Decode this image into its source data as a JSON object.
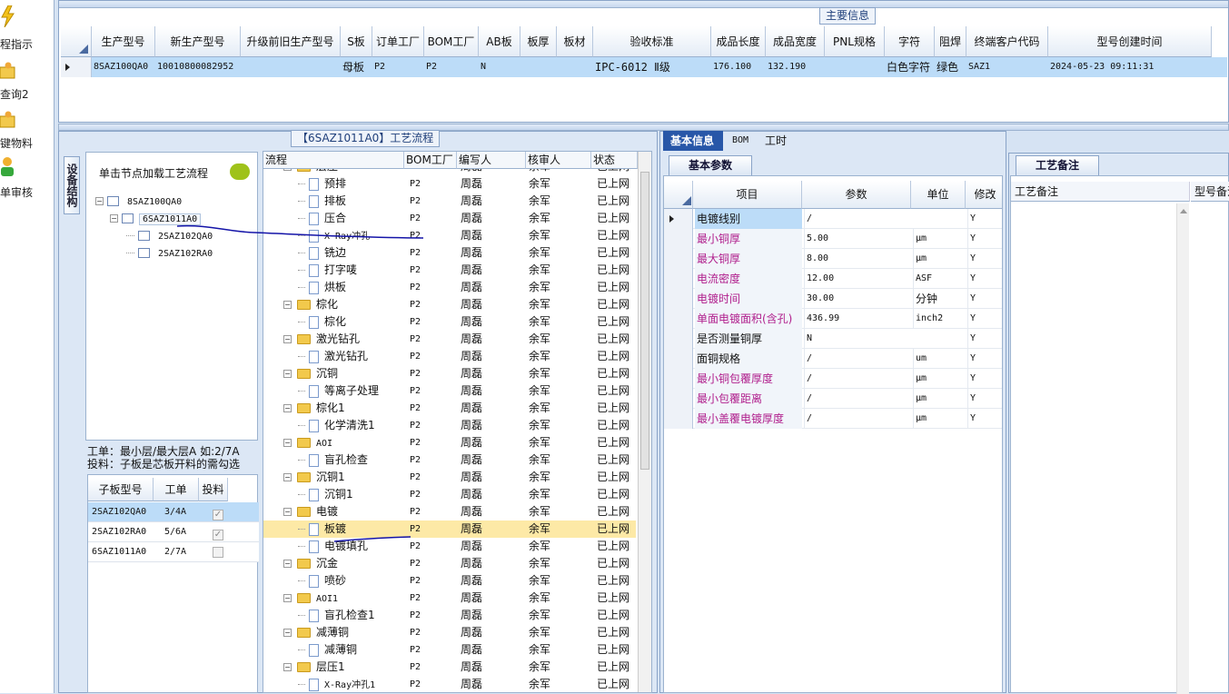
{
  "left_nav": {
    "items": [
      {
        "label": "程指示",
        "icon": "lightning-icon"
      },
      {
        "label": "查询2",
        "icon": "folder-person-icon"
      },
      {
        "label": "键物料",
        "icon": "folder-person-icon"
      },
      {
        "label": "单审核",
        "icon": "user-icon"
      }
    ]
  },
  "main_info": {
    "group_title": "主要信息",
    "columns": [
      "生产型号",
      "新生产型号",
      "升级前旧生产型号",
      "S板",
      "订单工厂",
      "BOM工厂",
      "AB板",
      "板厚",
      "板材",
      "验收标准",
      "成品长度",
      "成品宽度",
      "PNL规格",
      "字符",
      "阻焊",
      "终端客户代码",
      "型号创建时间"
    ],
    "row": [
      "8SAZ100QA0",
      "10010800082952",
      "",
      "母板",
      "P2",
      "P2",
      "N",
      "",
      "",
      "IPC-6012 Ⅱ级",
      "176.100",
      "132.190",
      "",
      "白色字符",
      "绿色",
      "SAZ1",
      "2024-05-23 09:11:31"
    ]
  },
  "flow_panel": {
    "title": "【6SAZ1011A0】工艺流程",
    "side_tab": "设备结构",
    "tree_hint": "单击节点加载工艺流程",
    "tree": [
      {
        "label": "8SAZ100QA0",
        "level": 0
      },
      {
        "label": "6SAZ1011A0",
        "level": 1
      },
      {
        "label": "2SAZ102QA0",
        "level": 2
      },
      {
        "label": "2SAZ102RA0",
        "level": 2
      }
    ],
    "note_line1": "工单：最小层/最大层A 如:2/7A",
    "note_line2": "投料：子板是芯板开料的需勾选",
    "sub_columns": [
      "子板型号",
      "工单",
      "投料"
    ],
    "sub_rows": [
      {
        "model": "2SAZ102QA0",
        "order": "3/4A",
        "feed": true
      },
      {
        "model": "2SAZ102RA0",
        "order": "5/6A",
        "feed": true
      },
      {
        "model": "6SAZ1011A0",
        "order": "2/7A",
        "feed": false
      }
    ],
    "flow_columns": [
      "流程",
      "BOM工厂",
      "编写人",
      "核审人",
      "状态"
    ],
    "flow_rows": [
      {
        "name": "层压",
        "type": "folder",
        "factory": "P2",
        "writer": "周磊",
        "checker": "余军",
        "status": "已上网"
      },
      {
        "name": "预排",
        "type": "doc",
        "factory": "P2",
        "writer": "周磊",
        "checker": "余军",
        "status": "已上网"
      },
      {
        "name": "排板",
        "type": "doc",
        "factory": "P2",
        "writer": "周磊",
        "checker": "余军",
        "status": "已上网"
      },
      {
        "name": "压合",
        "type": "doc",
        "factory": "P2",
        "writer": "周磊",
        "checker": "余军",
        "status": "已上网"
      },
      {
        "name": "X-Ray冲孔",
        "type": "doc",
        "factory": "P2",
        "writer": "周磊",
        "checker": "余军",
        "status": "已上网"
      },
      {
        "name": "铣边",
        "type": "doc",
        "factory": "P2",
        "writer": "周磊",
        "checker": "余军",
        "status": "已上网"
      },
      {
        "name": "打字唛",
        "type": "doc",
        "factory": "P2",
        "writer": "周磊",
        "checker": "余军",
        "status": "已上网"
      },
      {
        "name": "烘板",
        "type": "doc",
        "factory": "P2",
        "writer": "周磊",
        "checker": "余军",
        "status": "已上网"
      },
      {
        "name": "棕化",
        "type": "folder",
        "factory": "P2",
        "writer": "周磊",
        "checker": "余军",
        "status": "已上网"
      },
      {
        "name": "棕化",
        "type": "doc",
        "factory": "P2",
        "writer": "周磊",
        "checker": "余军",
        "status": "已上网"
      },
      {
        "name": "激光钻孔",
        "type": "folder",
        "factory": "P2",
        "writer": "周磊",
        "checker": "余军",
        "status": "已上网"
      },
      {
        "name": "激光钻孔",
        "type": "doc",
        "factory": "P2",
        "writer": "周磊",
        "checker": "余军",
        "status": "已上网"
      },
      {
        "name": "沉铜",
        "type": "folder",
        "factory": "P2",
        "writer": "周磊",
        "checker": "余军",
        "status": "已上网"
      },
      {
        "name": "等离子处理",
        "type": "doc",
        "factory": "P2",
        "writer": "周磊",
        "checker": "余军",
        "status": "已上网"
      },
      {
        "name": "棕化1",
        "type": "folder",
        "factory": "P2",
        "writer": "周磊",
        "checker": "余军",
        "status": "已上网"
      },
      {
        "name": "化学清洗1",
        "type": "doc",
        "factory": "P2",
        "writer": "周磊",
        "checker": "余军",
        "status": "已上网"
      },
      {
        "name": "AOI",
        "type": "folder",
        "factory": "P2",
        "writer": "周磊",
        "checker": "余军",
        "status": "已上网"
      },
      {
        "name": "盲孔检查",
        "type": "doc",
        "factory": "P2",
        "writer": "周磊",
        "checker": "余军",
        "status": "已上网"
      },
      {
        "name": "沉铜1",
        "type": "folder",
        "factory": "P2",
        "writer": "周磊",
        "checker": "余军",
        "status": "已上网"
      },
      {
        "name": "沉铜1",
        "type": "doc",
        "factory": "P2",
        "writer": "周磊",
        "checker": "余军",
        "status": "已上网"
      },
      {
        "name": "电镀",
        "type": "folder",
        "factory": "P2",
        "writer": "周磊",
        "checker": "余军",
        "status": "已上网"
      },
      {
        "name": "板镀",
        "type": "doc",
        "factory": "P2",
        "writer": "周磊",
        "checker": "余军",
        "status": "已上网",
        "selected": true
      },
      {
        "name": "电镀填孔",
        "type": "doc",
        "factory": "P2",
        "writer": "周磊",
        "checker": "余军",
        "status": "已上网"
      },
      {
        "name": "沉金",
        "type": "folder",
        "factory": "P2",
        "writer": "周磊",
        "checker": "余军",
        "status": "已上网"
      },
      {
        "name": "喷砂",
        "type": "doc",
        "factory": "P2",
        "writer": "周磊",
        "checker": "余军",
        "status": "已上网"
      },
      {
        "name": "AOI1",
        "type": "folder",
        "factory": "P2",
        "writer": "周磊",
        "checker": "余军",
        "status": "已上网"
      },
      {
        "name": "盲孔检查1",
        "type": "doc",
        "factory": "P2",
        "writer": "周磊",
        "checker": "余军",
        "status": "已上网"
      },
      {
        "name": "减薄铜",
        "type": "folder",
        "factory": "P2",
        "writer": "周磊",
        "checker": "余军",
        "status": "已上网"
      },
      {
        "name": "减薄铜",
        "type": "doc",
        "factory": "P2",
        "writer": "周磊",
        "checker": "余军",
        "status": "已上网"
      },
      {
        "name": "层压1",
        "type": "folder",
        "factory": "P2",
        "writer": "周磊",
        "checker": "余军",
        "status": "已上网"
      },
      {
        "name": "X-Ray冲孔1",
        "type": "doc",
        "factory": "P2",
        "writer": "周磊",
        "checker": "余军",
        "status": "已上网"
      }
    ]
  },
  "detail_panel": {
    "tabs": [
      "基本信息",
      "BOM",
      "工时"
    ],
    "subtab": "基本参数",
    "columns": [
      "项目",
      "参数",
      "单位",
      "修改"
    ],
    "rows": [
      {
        "item": "电镀线别",
        "param": "/",
        "unit": "",
        "mod": "Y",
        "pink": false
      },
      {
        "item": "最小铜厚",
        "param": "5.00",
        "unit": "μm",
        "mod": "Y",
        "pink": true
      },
      {
        "item": "最大铜厚",
        "param": "8.00",
        "unit": "μm",
        "mod": "Y",
        "pink": true
      },
      {
        "item": "电流密度",
        "param": "12.00",
        "unit": "ASF",
        "mod": "Y",
        "pink": true
      },
      {
        "item": "电镀时间",
        "param": "30.00",
        "unit": "分钟",
        "mod": "Y",
        "pink": true
      },
      {
        "item": "单面电镀面积(含孔)",
        "param": "436.99",
        "unit": "inch2",
        "mod": "Y",
        "pink": true
      },
      {
        "item": "是否测量铜厚",
        "param": "N",
        "unit": "",
        "mod": "Y",
        "pink": false
      },
      {
        "item": "面铜规格",
        "param": "/",
        "unit": "um",
        "mod": "Y",
        "pink": false
      },
      {
        "item": "最小铜包覆厚度",
        "param": "/",
        "unit": "μm",
        "mod": "Y",
        "pink": true
      },
      {
        "item": "最小包覆距离",
        "param": "/",
        "unit": "μm",
        "mod": "Y",
        "pink": true
      },
      {
        "item": "最小盖覆电镀厚度",
        "param": "/",
        "unit": "μm",
        "mod": "Y",
        "pink": true
      }
    ]
  },
  "remark_panel": {
    "tab": "工艺备注",
    "columns": [
      "工艺备注",
      "型号备注"
    ]
  },
  "colors": {
    "selected_row": "#bcdcf8",
    "highlight_row": "#fde9a6",
    "pink_text": "#b01e8c",
    "annotation": "#1414a8"
  }
}
